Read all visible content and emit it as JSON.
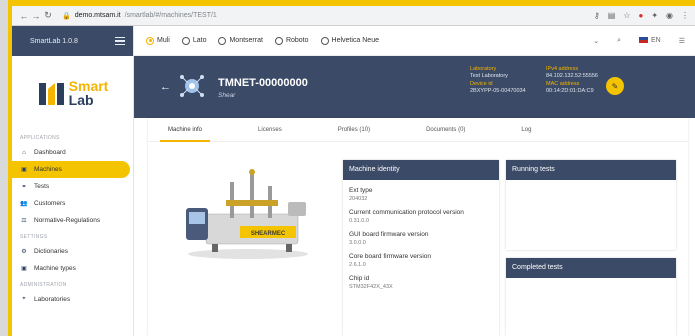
{
  "browser": {
    "url_host": "demo.mtsam.it",
    "url_path": "/smartlab/#/machines/TEST/1"
  },
  "sidebar": {
    "app_title": "SmartLab 1.0.8",
    "logo_word1": "Smart",
    "logo_word2": "Lab",
    "sections": [
      "APPLICATIONS",
      "SETTINGS",
      "ADMINISTRATION"
    ],
    "items_app": [
      {
        "label": "Dashboard",
        "icon": "home-icon"
      },
      {
        "label": "Machines",
        "icon": "machine-icon"
      },
      {
        "label": "Tests",
        "icon": "tests-icon"
      },
      {
        "label": "Customers",
        "icon": "customers-icon"
      },
      {
        "label": "Normative-Regulations",
        "icon": "scale-icon"
      }
    ],
    "items_settings": [
      {
        "label": "Dictionaries",
        "icon": "gear-icon"
      },
      {
        "label": "Machine types",
        "icon": "machine-icon"
      }
    ],
    "items_admin": [
      {
        "label": "Laboratories",
        "icon": "lab-icon"
      }
    ],
    "active": "Machines"
  },
  "toolbar": {
    "fonts": [
      "Muli",
      "Lato",
      "Montserrat",
      "Roboto",
      "Helvetica Neue"
    ],
    "selected_font": "Muli",
    "language": "EN"
  },
  "machine": {
    "name": "TMNET-00000000",
    "subtitle": "Shear",
    "laboratory_label": "Laboratory",
    "laboratory_value": "Test Laboratory",
    "device_id_label": "Device id",
    "device_id_value": "2BXYPP-05-00470034",
    "ipv4_label": "IPv4 address",
    "ipv4_value": "84.102.132.52:55556",
    "mac_label": "MAC address",
    "mac_value": "00:14:2D:01:DA:C9",
    "image_brand": "SHEARMEC"
  },
  "tabs": [
    "Machine info",
    "Licenses",
    "Profiles (10)",
    "Documents (0)",
    "Log"
  ],
  "active_tab": "Machine info",
  "identity": {
    "title": "Machine identity",
    "fields": [
      {
        "key": "Ext type",
        "value": "204032"
      },
      {
        "key": "Current communication protocol version",
        "value": "0.31.0.0"
      },
      {
        "key": "GUI board firmware version",
        "value": "3.0.0.0"
      },
      {
        "key": "Core board firmware version",
        "value": "2.6.1.0"
      },
      {
        "key": "Chip id",
        "value": "STM32F42X_43X"
      }
    ]
  },
  "running_tests_title": "Running tests",
  "completed_tests_title": "Completed tests",
  "colors": {
    "accent": "#f4c400",
    "navy": "#3b4a66"
  }
}
